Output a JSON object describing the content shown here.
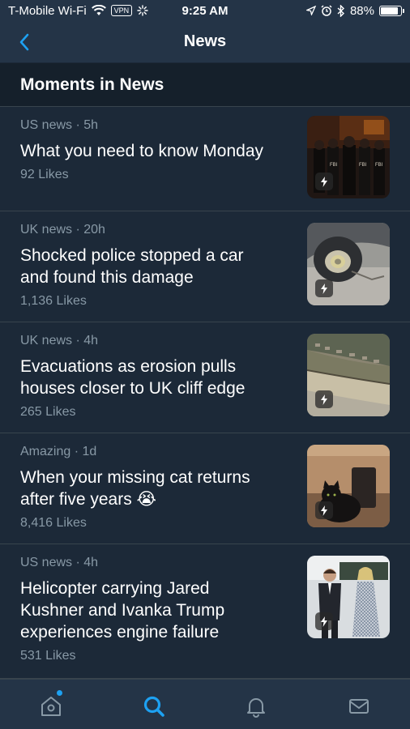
{
  "status_bar": {
    "carrier": "T-Mobile Wi-Fi",
    "vpn": "VPN",
    "time": "9:25 AM",
    "battery": "88%",
    "battery_level": 0.88
  },
  "nav": {
    "title": "News",
    "back_icon": "chevron-left-icon"
  },
  "section": {
    "title": "Moments in News"
  },
  "items": [
    {
      "category": "US news",
      "age": "5h",
      "title_lines": [
        "What you need to know Monday"
      ],
      "likes": "92 Likes",
      "thumb": "police-night-photo"
    },
    {
      "category": "UK news",
      "age": "20h",
      "title_lines": [
        "Shocked police stopped a car",
        "and found this damage"
      ],
      "likes": "1,136 Likes",
      "thumb": "damaged-wheel-photo"
    },
    {
      "category": "UK news",
      "age": "4h",
      "title_lines": [
        "Evacuations as erosion pulls",
        "houses closer to UK cliff edge"
      ],
      "likes": "265 Likes",
      "thumb": "coastal-erosion-photo"
    },
    {
      "category": "Amazing",
      "age": "1d",
      "title_lines": [
        "When your missing cat returns",
        "after five years 😭"
      ],
      "likes": "8,416 Likes",
      "thumb": "black-cat-photo"
    },
    {
      "category": "US news",
      "age": "4h",
      "title_lines": [
        "Helicopter carrying Jared",
        "Kushner and Ivanka Trump",
        "experiences engine failure"
      ],
      "likes": "531 Likes",
      "thumb": "couple-walking-photo"
    }
  ],
  "tabs": [
    {
      "name": "home",
      "icon": "home-icon",
      "active": false,
      "has_notification": true
    },
    {
      "name": "search",
      "icon": "search-icon",
      "active": true,
      "has_notification": false
    },
    {
      "name": "notifications",
      "icon": "bell-icon",
      "active": false,
      "has_notification": false
    },
    {
      "name": "messages",
      "icon": "envelope-icon",
      "active": false,
      "has_notification": false
    }
  ],
  "colors": {
    "accent": "#1da1f2",
    "background": "#15202b",
    "card": "#1c2938",
    "secondary_text": "#8899a6"
  }
}
